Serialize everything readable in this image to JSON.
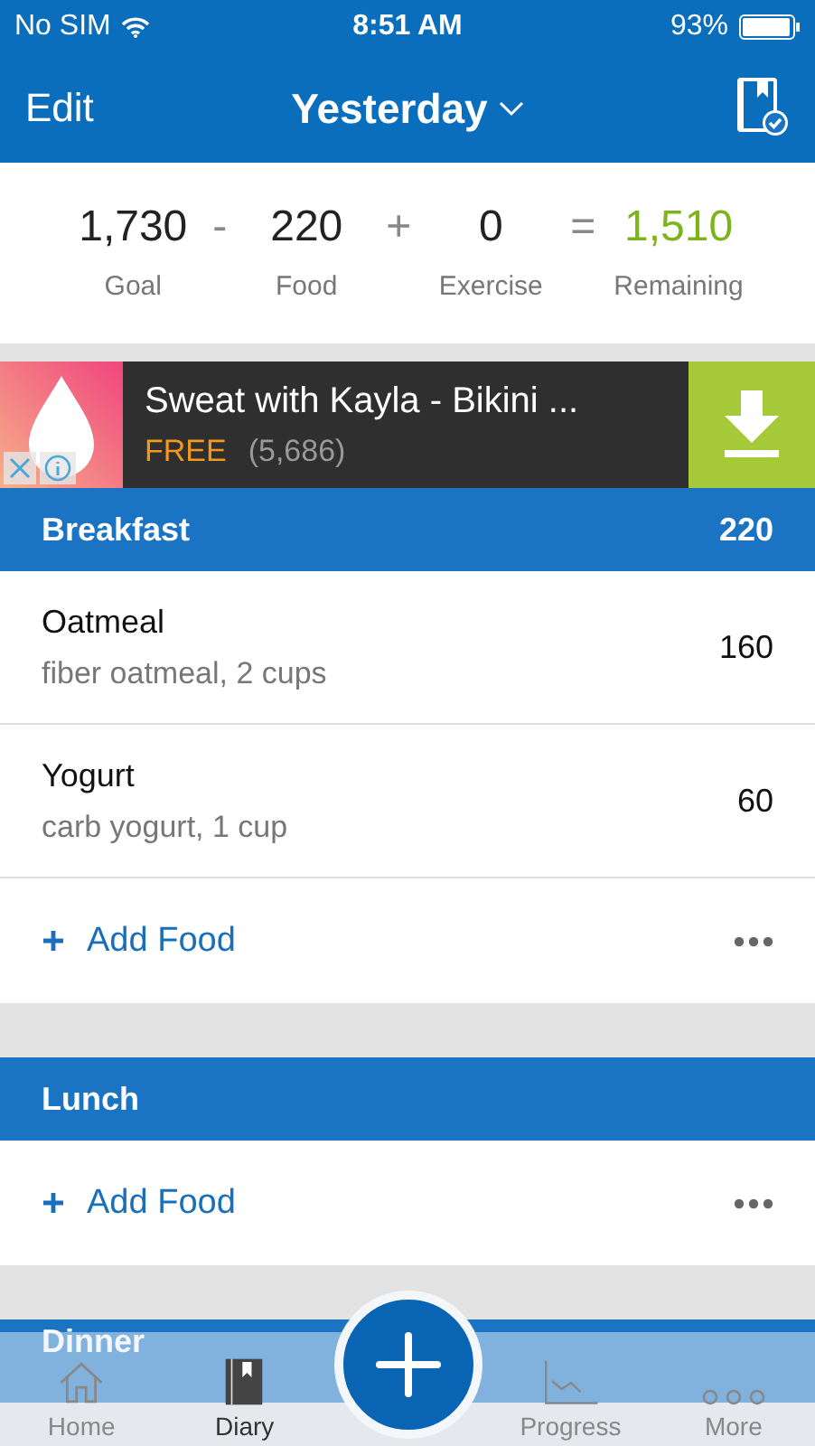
{
  "status_bar": {
    "carrier": "No SIM",
    "time": "8:51 AM",
    "battery": "93%"
  },
  "nav_bar": {
    "left": "Edit",
    "title": "Yesterday"
  },
  "summary": [
    {
      "value": "1,730",
      "label": "Goal",
      "operator": "-",
      "kind": "plain"
    },
    {
      "value": "220",
      "label": "Food",
      "operator": "+",
      "kind": "plain"
    },
    {
      "value": "0",
      "label": "Exercise",
      "operator": "=",
      "kind": "plain"
    },
    {
      "value": "1,510",
      "label": "Remaining",
      "kind": "result"
    }
  ],
  "ad": {
    "title": "Sweat with Kayla - Bikini ...",
    "price": "FREE",
    "count": "(5,686)"
  },
  "meals": [
    {
      "name": "Breakfast",
      "calories": "220",
      "items": [
        {
          "name": "Oatmeal",
          "detail": "fiber oatmeal, 2 cups",
          "calories": "160"
        },
        {
          "name": "Yogurt",
          "detail": "carb yogurt, 1 cup",
          "calories": "60"
        }
      ],
      "add_label": "Add Food"
    },
    {
      "name": "Lunch",
      "add_label": "Add Food"
    },
    {
      "name": "Dinner"
    }
  ],
  "tab_bar": [
    {
      "label": "Home",
      "kind": "home",
      "selected": false
    },
    {
      "label": "Diary",
      "kind": "diary",
      "selected": true
    },
    {
      "kind": "add"
    },
    {
      "label": "Progress",
      "kind": "progress",
      "selected": false
    },
    {
      "label": "More",
      "kind": "more",
      "selected": false
    }
  ]
}
